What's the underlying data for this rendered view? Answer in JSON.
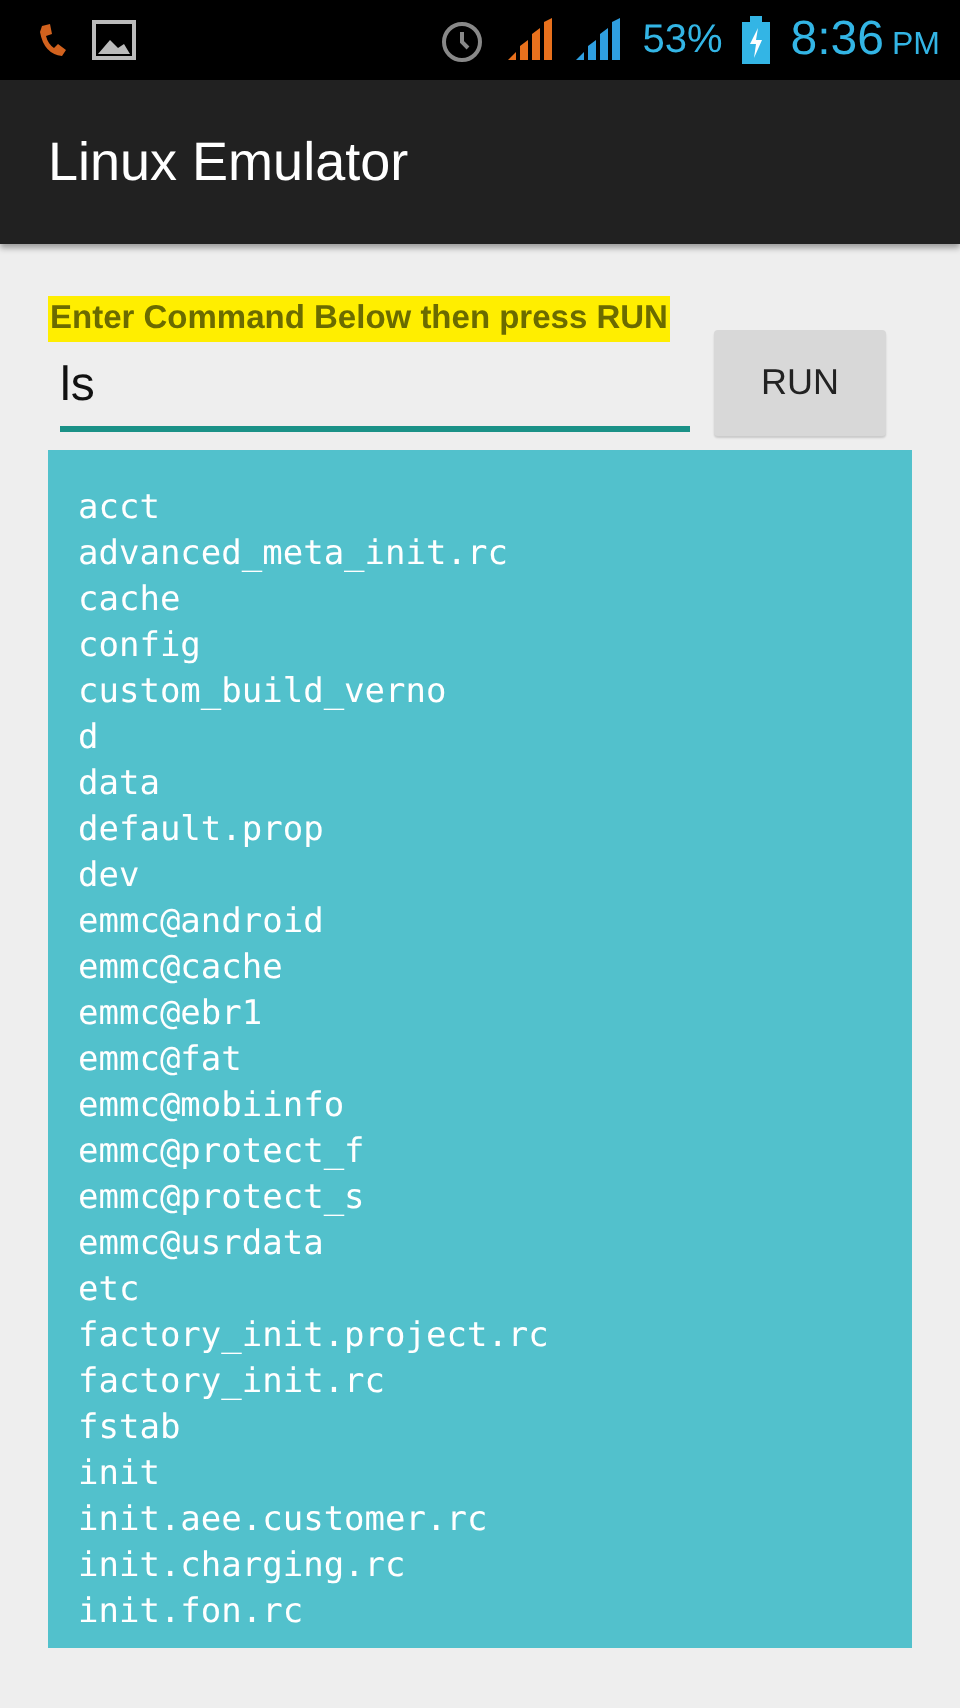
{
  "status_bar": {
    "battery": "53%",
    "time": "8:36",
    "ampm": "PM"
  },
  "app_bar": {
    "title": "Linux Emulator"
  },
  "prompt": "Enter Command Below then press RUN",
  "command": {
    "value": "ls"
  },
  "run_button": "RUN",
  "output": [
    "acct",
    "advanced_meta_init.rc",
    "cache",
    "config",
    "custom_build_verno",
    "d",
    "data",
    "default.prop",
    "dev",
    "emmc@android",
    "emmc@cache",
    "emmc@ebr1",
    "emmc@fat",
    "emmc@mobiinfo",
    "emmc@protect_f",
    "emmc@protect_s",
    "emmc@usrdata",
    "etc",
    "factory_init.project.rc",
    "factory_init.rc",
    "fstab",
    "init",
    "init.aee.customer.rc",
    "init.charging.rc",
    "init.fon.rc"
  ]
}
